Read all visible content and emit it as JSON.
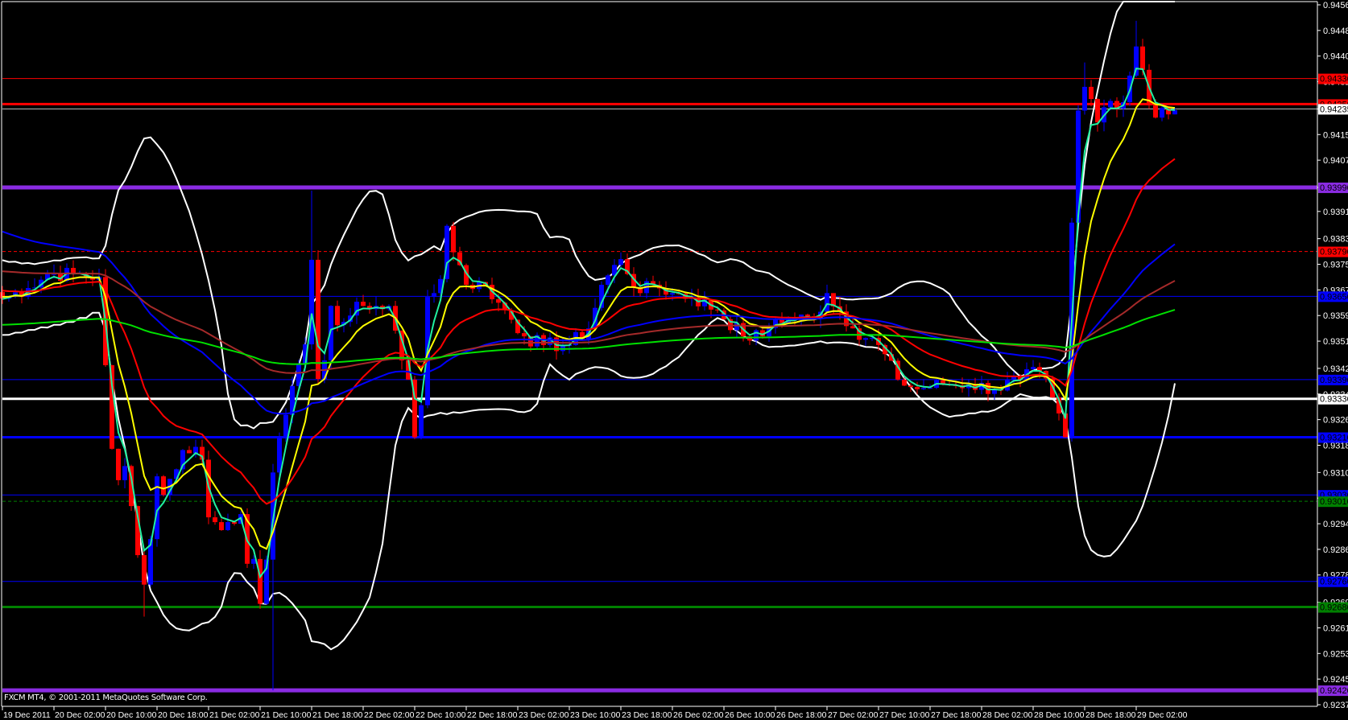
{
  "window": {
    "copyright": "FXCM MT4, © 2001-2011 MetaQuotes Software Corp."
  },
  "colors": {
    "background": "#000000",
    "axis": "#ffffff",
    "bull": "#0000ff",
    "bear": "#ff0000"
  },
  "chart_data": {
    "type": "candlestick",
    "title": "",
    "ylim": [
      0.92375,
      0.9456
    ],
    "y_ticks": [
      "0.94560",
      "0.94480",
      "0.94400",
      "0.94320",
      "0.94235",
      "0.94155",
      "0.94075",
      "0.93990",
      "0.93915",
      "0.93830",
      "0.93750",
      "0.93670",
      "0.93590",
      "0.93510",
      "0.93425",
      "0.93345",
      "0.93265",
      "0.93185",
      "0.93100",
      "0.93020",
      "0.92940",
      "0.92860",
      "0.92780",
      "0.92695",
      "0.92615",
      "0.92535",
      "0.92455",
      "0.92375"
    ],
    "x_ticks": [
      "19 Dec 2011",
      "20 Dec 02:00",
      "20 Dec 10:00",
      "20 Dec 18:00",
      "21 Dec 02:00",
      "21 Dec 10:00",
      "21 Dec 18:00",
      "22 Dec 02:00",
      "22 Dec 10:00",
      "22 Dec 18:00",
      "23 Dec 02:00",
      "23 Dec 10:00",
      "23 Dec 18:00",
      "26 Dec 02:00",
      "26 Dec 10:00",
      "26 Dec 18:00",
      "27 Dec 02:00",
      "27 Dec 10:00",
      "27 Dec 18:00",
      "28 Dec 02:00",
      "28 Dec 10:00",
      "28 Dec 18:00",
      "29 Dec 02:00"
    ],
    "bars_per_x_tick": 8,
    "bar_count": 183,
    "close_keypoints": [
      [
        0,
        0.93643
      ],
      [
        4,
        0.93676
      ],
      [
        7,
        0.93719
      ],
      [
        11,
        0.9372
      ],
      [
        15,
        0.9371
      ],
      [
        16,
        0.93435
      ],
      [
        17,
        0.93174
      ],
      [
        18,
        0.93076
      ],
      [
        19,
        0.9312
      ],
      [
        21,
        0.92842
      ],
      [
        22,
        0.9275
      ],
      [
        23,
        0.92892
      ],
      [
        24,
        0.93088
      ],
      [
        25,
        0.9303
      ],
      [
        26,
        0.9308
      ],
      [
        27,
        0.9311
      ],
      [
        28,
        0.9317
      ],
      [
        29,
        0.9316
      ],
      [
        30,
        0.9318
      ],
      [
        31,
        0.9314
      ],
      [
        32,
        0.9296
      ],
      [
        33,
        0.92945
      ],
      [
        34,
        0.9292
      ],
      [
        35,
        0.92945
      ],
      [
        36,
        0.9294
      ],
      [
        37,
        0.9297
      ],
      [
        38,
        0.92815
      ],
      [
        39,
        0.9283
      ],
      [
        40,
        0.9269
      ],
      [
        41,
        0.92828
      ],
      [
        42,
        0.931
      ],
      [
        43,
        0.9321
      ],
      [
        44,
        0.9328
      ],
      [
        45,
        0.9337
      ],
      [
        46,
        0.9344
      ],
      [
        47,
        0.935
      ],
      [
        48,
        0.93764
      ],
      [
        49,
        0.93392
      ],
      [
        50,
        0.9345
      ],
      [
        51,
        0.9362
      ],
      [
        52,
        0.9356
      ],
      [
        53,
        0.9357
      ],
      [
        54,
        0.9359
      ],
      [
        55,
        0.93633
      ],
      [
        56,
        0.9362
      ],
      [
        57,
        0.9361
      ],
      [
        58,
        0.9362
      ],
      [
        59,
        0.9361
      ],
      [
        60,
        0.9362
      ],
      [
        62,
        0.9345
      ],
      [
        63,
        0.9339
      ],
      [
        64,
        0.9321
      ],
      [
        65,
        0.9331
      ],
      [
        66,
        0.93648
      ],
      [
        67,
        0.9366
      ],
      [
        68,
        0.93704
      ],
      [
        69,
        0.9387
      ],
      [
        72,
        0.93686
      ],
      [
        75,
        0.93686
      ],
      [
        77,
        0.9363
      ],
      [
        81,
        0.93525
      ],
      [
        84,
        0.93498
      ],
      [
        88,
        0.93498
      ],
      [
        91,
        0.9355
      ],
      [
        93,
        0.93686
      ],
      [
        96,
        0.93766
      ],
      [
        99,
        0.9366
      ],
      [
        101,
        0.93686
      ],
      [
        104,
        0.9366
      ],
      [
        107,
        0.93646
      ],
      [
        111,
        0.93606
      ],
      [
        115,
        0.93525
      ],
      [
        118,
        0.93525
      ],
      [
        120,
        0.9358
      ],
      [
        126,
        0.9358
      ],
      [
        128,
        0.9366
      ],
      [
        132,
        0.9355
      ],
      [
        136,
        0.93498
      ],
      [
        139,
        0.9339
      ],
      [
        142,
        0.9336
      ],
      [
        146,
        0.93375
      ],
      [
        150,
        0.93375
      ],
      [
        154,
        0.9336
      ],
      [
        158,
        0.9339
      ],
      [
        161,
        0.93417
      ],
      [
        163,
        0.93334
      ],
      [
        165,
        0.9321
      ],
      [
        166,
        0.9388
      ],
      [
        167,
        0.9423
      ],
      [
        168,
        0.94304
      ],
      [
        169,
        0.94266
      ],
      [
        170,
        0.94193
      ],
      [
        171,
        0.9424
      ],
      [
        172,
        0.9426
      ],
      [
        173,
        0.94236
      ],
      [
        174,
        0.94256
      ],
      [
        175,
        0.94339
      ],
      [
        176,
        0.9443
      ],
      [
        177,
        0.94357
      ],
      [
        178,
        0.94246
      ],
      [
        179,
        0.94208
      ],
      [
        180,
        0.94238
      ],
      [
        181,
        0.94218
      ],
      [
        182,
        0.94231
      ]
    ],
    "wick_extremes": [
      [
        22,
        "low",
        0.9265
      ],
      [
        42,
        "low",
        0.9242
      ],
      [
        48,
        "high",
        0.9398
      ],
      [
        176,
        "high",
        0.9451
      ],
      [
        168,
        "high",
        0.9438
      ]
    ],
    "moving_averages": [
      {
        "name": "ema-3",
        "period": 3,
        "color": "#20f0a0",
        "seed": 0.9364
      },
      {
        "name": "ema-8",
        "period": 8,
        "color": "#ffff00",
        "seed": 0.9365
      },
      {
        "name": "ema-21",
        "period": 21,
        "color": "#ff0000",
        "seed": 0.9367
      },
      {
        "name": "ema-55",
        "period": 55,
        "color": "#0000ff",
        "seed": 0.9386
      },
      {
        "name": "ema-100",
        "period": 100,
        "color": "#a52a2a",
        "seed": 0.9373
      },
      {
        "name": "ema-200",
        "period": 200,
        "color": "#00e000",
        "seed": 0.9356
      }
    ],
    "bollinger": {
      "period": 20,
      "deviations": 2,
      "color": "#ffffff"
    },
    "levels": [
      {
        "price": 0.9433,
        "label": "0.94330",
        "color": "#ff0000",
        "weight": 1,
        "style": "solid",
        "text": "#000000"
      },
      {
        "price": 0.9425,
        "label": "0.94250",
        "color": "#ff0000",
        "weight": 3,
        "style": "solid",
        "text": "#000000"
      },
      {
        "price": 0.94235,
        "label": "0.94235",
        "color": "#c0c0c0",
        "weight": 1,
        "style": "solid",
        "text": "#000000",
        "box": "#ffffff"
      },
      {
        "price": 0.9399,
        "label": "0.93990",
        "color": "#8a2be2",
        "weight": 5,
        "style": "solid",
        "text": "#000000"
      },
      {
        "price": 0.9379,
        "label": "0.93790",
        "color": "#ff0000",
        "weight": 1,
        "style": "dash",
        "text": "#000000"
      },
      {
        "price": 0.9365,
        "label": "0.93650",
        "color": "#0000ff",
        "weight": 1,
        "style": "solid",
        "text": "#000000"
      },
      {
        "price": 0.9339,
        "label": "0.93390",
        "color": "#0000ff",
        "weight": 1,
        "style": "solid",
        "text": "#000000"
      },
      {
        "price": 0.9333,
        "label": "0.93330",
        "color": "#ffffff",
        "weight": 3,
        "style": "solid",
        "text": "#000000"
      },
      {
        "price": 0.9321,
        "label": "0.93210",
        "color": "#0000ff",
        "weight": 3,
        "style": "solid",
        "text": "#000000"
      },
      {
        "price": 0.9303,
        "label": "0.93030",
        "color": "#0000ff",
        "weight": 1,
        "style": "solid",
        "text": "#000000"
      },
      {
        "price": 0.9301,
        "label": "0.93010",
        "color": "#008000",
        "weight": 1,
        "style": "dash",
        "text": "#000000"
      },
      {
        "price": 0.9276,
        "label": "0.92760",
        "color": "#0000ff",
        "weight": 1,
        "style": "solid",
        "text": "#000000"
      },
      {
        "price": 0.9268,
        "label": "0.92680",
        "color": "#008000",
        "weight": 3,
        "style": "solid",
        "text": "#000000"
      },
      {
        "price": 0.9242,
        "label": "0.92420",
        "color": "#8a2be2",
        "weight": 5,
        "style": "solid",
        "text": "#000000"
      }
    ]
  }
}
